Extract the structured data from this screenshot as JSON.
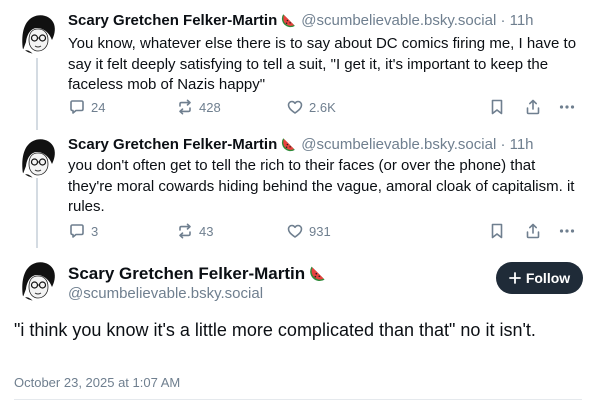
{
  "colors": {
    "accent": "#1f2b38",
    "muted": "#6f7f8f",
    "text": "#0b0f14",
    "thread": "#d4dbe2"
  },
  "posts": [
    {
      "name": "Scary Gretchen Felker-Martin",
      "handle": "@scumbelievable.bsky.social",
      "time": "· 11h",
      "text": "You know, whatever else there is to say about DC comics firing me, I have to say it felt deeply satisfying to tell a suit, \"I get it, it's important to keep the faceless mob of Nazis happy\"",
      "replies": "24",
      "reposts": "428",
      "likes": "2.6K"
    },
    {
      "name": "Scary Gretchen Felker-Martin",
      "handle": "@scumbelievable.bsky.social",
      "time": "· 11h",
      "text": "you don't often get to tell the rich to their faces (or over the phone) that they're moral cowards hiding behind the vague, amoral cloak of capitalism. it rules.",
      "replies": "3",
      "reposts": "43",
      "likes": "931"
    }
  ],
  "main_post": {
    "name": "Scary Gretchen Felker-Martin",
    "handle": "@scumbelievable.bsky.social",
    "follow_label": "Follow",
    "text": "\"i think you know it's a little more complicated than that\" no it isn't.",
    "date": "October 23, 2025 at 1:07 AM"
  },
  "icons": [
    "avatar",
    "watermelon-icon",
    "reply-icon",
    "repost-icon",
    "like-icon",
    "bookmark-icon",
    "share-icon",
    "more-icon",
    "plus-icon"
  ]
}
